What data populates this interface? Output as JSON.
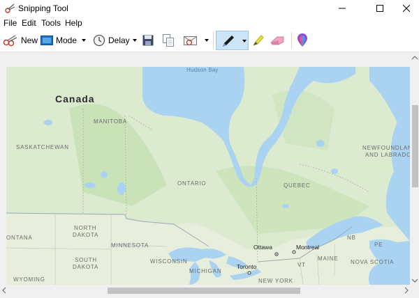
{
  "window": {
    "title": "Snipping Tool",
    "controls": [
      "minimize",
      "maximize",
      "close"
    ]
  },
  "menu": [
    "File",
    "Edit",
    "Tools",
    "Help"
  ],
  "toolbar": {
    "new_label": "New",
    "mode_label": "Mode",
    "delay_label": "Delay",
    "icons": [
      "new-snip-icon",
      "mode-icon",
      "delay-clock-icon",
      "save-icon",
      "copy-icon",
      "send-email-icon",
      "pen-icon",
      "highlighter-icon",
      "eraser-icon",
      "paint3d-icon"
    ],
    "accent": "#cce4f7"
  },
  "map": {
    "labels": {
      "hudson_bay": "Hudson Bay",
      "canada": "Canada",
      "manitoba": "MANITOBA",
      "saskatchewan": "SASKATCHEWAN",
      "ontario": "ONTARIO",
      "quebec": "QUEBEC",
      "newfoundland_1": "NEWFOUNDLAN",
      "newfoundland_2": "AND LABRADO",
      "north_dakota_1": "NORTH",
      "north_dakota_2": "DAKOTA",
      "montana": "ONTANA",
      "minnesota": "MINNESOTA",
      "south_dakota_1": "SOUTH",
      "south_dakota_2": "DAKOTA",
      "wisconsin": "WISCONSIN",
      "michigan": "MICHIGAN",
      "wyoming": "WYOMING",
      "ottawa": "Ottawa",
      "montreal": "Montreal",
      "toronto": "Toronto",
      "nb": "NB",
      "pe": "PE",
      "maine": "MAINE",
      "nova_scotia": "NOVA SCOTIA",
      "vt": "VT",
      "new_york": "NEW YORK"
    },
    "colors": {
      "land": "#dcebd0",
      "forest": "#c9e2b8",
      "water": "#aad3f2",
      "us_land": "#e7eedb"
    }
  }
}
